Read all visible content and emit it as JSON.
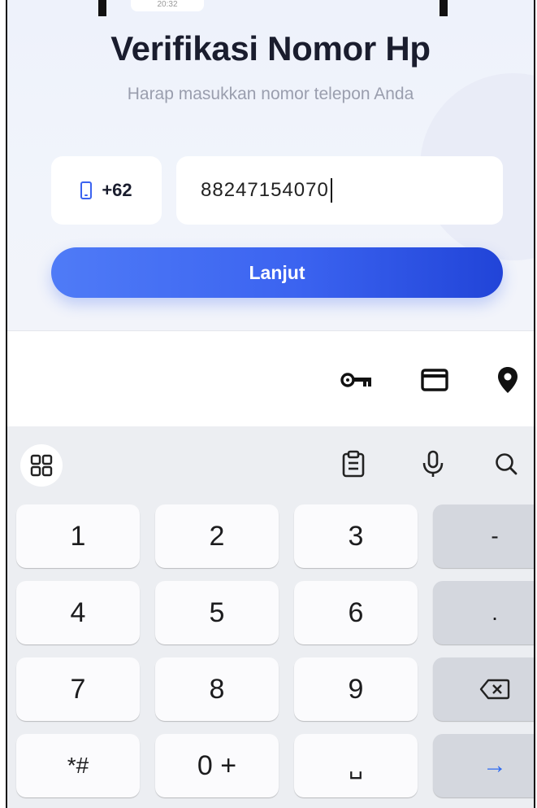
{
  "status_bar": {
    "time": "20:32"
  },
  "page": {
    "title": "Verifikasi Nomor Hp",
    "subtitle": "Harap masukkan nomor telepon Anda"
  },
  "form": {
    "country_code": "+62",
    "phone_value": "88247154070",
    "submit_label": "Lanjut"
  },
  "autofill_bar": {
    "icons": [
      "key-icon",
      "card-icon",
      "location-pin-icon"
    ]
  },
  "keyboard": {
    "toolbar_icons": [
      "apps-grid-icon",
      "clipboard-icon",
      "microphone-icon",
      "search-icon"
    ],
    "rows": [
      [
        "1",
        "2",
        "3",
        "-"
      ],
      [
        "4",
        "5",
        "6",
        "."
      ],
      [
        "7",
        "8",
        "9",
        "⌫"
      ],
      [
        "*#",
        "0 +",
        "␣",
        "→"
      ]
    ]
  },
  "colors": {
    "accent": "#3b63f0",
    "title": "#1a1d2e",
    "subtitle": "#9a9eae",
    "keyboard_bg": "#eceef2",
    "function_key": "#d4d7de"
  }
}
